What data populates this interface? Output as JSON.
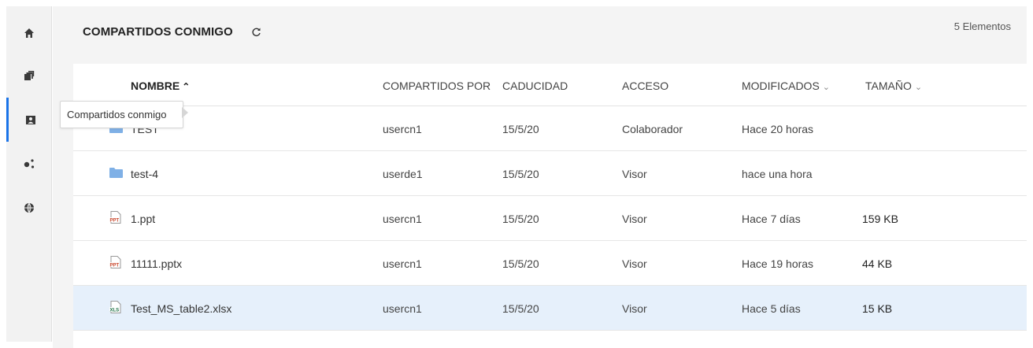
{
  "sidebar": {
    "items": [
      {
        "icon": "home-icon",
        "active": false
      },
      {
        "icon": "my-files-icon",
        "active": false
      },
      {
        "icon": "shared-with-me-icon",
        "active": true
      },
      {
        "icon": "shared-by-me-icon",
        "active": false
      },
      {
        "icon": "network-folders-icon",
        "active": false
      }
    ],
    "tooltip": "Compartidos conmigo"
  },
  "header": {
    "title": "COMPARTIDOS CONMIGO",
    "count": "5 Elementos"
  },
  "table": {
    "columns": {
      "name": "NOMBRE",
      "shared_by": "COMPARTIDOS POR",
      "expiry": "CADUCIDAD",
      "access": "ACCESO",
      "modified": "MODIFICADOS",
      "size": "TAMAÑO"
    },
    "rows": [
      {
        "type": "folder",
        "name": "TEST",
        "shared_by": "usercn1",
        "expiry": "15/5/20",
        "access": "Colaborador",
        "modified": "Hace 20 horas",
        "size": ""
      },
      {
        "type": "folder",
        "name": "test-4",
        "shared_by": "userde1",
        "expiry": "15/5/20",
        "access": "Visor",
        "modified": "hace una hora",
        "size": ""
      },
      {
        "type": "ppt",
        "name": "1.ppt",
        "shared_by": "usercn1",
        "expiry": "15/5/20",
        "access": "Visor",
        "modified": "Hace 7 días",
        "size": "159 KB"
      },
      {
        "type": "ppt",
        "name": "11111.pptx",
        "shared_by": "usercn1",
        "expiry": "15/5/20",
        "access": "Visor",
        "modified": "Hace 19 horas",
        "size": "44 KB"
      },
      {
        "type": "xls",
        "name": "Test_MS_table2.xlsx",
        "shared_by": "usercn1",
        "expiry": "15/5/20",
        "access": "Visor",
        "modified": "Hace 5 días",
        "size": "15 KB"
      }
    ]
  },
  "colors": {
    "accent": "#1a73e8",
    "folder": "#7fb0e6",
    "ppt": "#c8472c",
    "xls": "#1e7145",
    "selected_row": "#e6f0fb"
  }
}
